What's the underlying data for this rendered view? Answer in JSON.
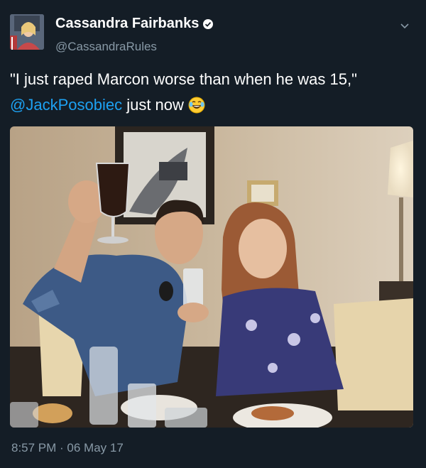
{
  "tweet": {
    "display_name": "Cassandra Fairbanks",
    "handle": "@CassandraRules",
    "text_part1": "\"I just raped Marcon worse than when he was 15,\"",
    "mention": "@JackPosobiec",
    "text_part2": "just now",
    "timestamp": "8:57 PM · 06 May 17"
  },
  "icons": {
    "verified": "verified-badge-icon",
    "caret": "chevron-down-icon",
    "emoji": "laughing-with-tears-emoji"
  },
  "colors": {
    "background": "#141d26",
    "text": "#ffffff",
    "secondary_text": "#8899a6",
    "link": "#1da1f2"
  }
}
